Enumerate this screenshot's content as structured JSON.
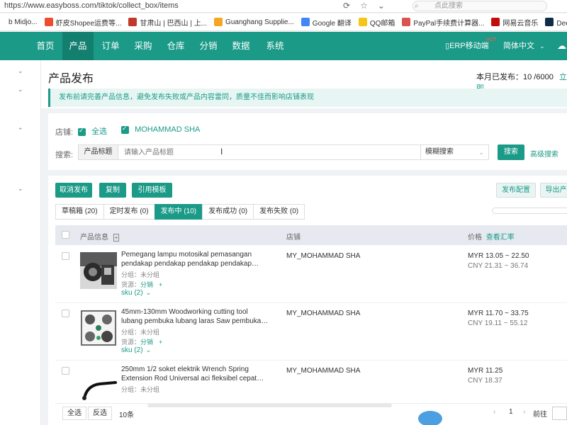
{
  "browser": {
    "url": "https://www.easyboss.com/tiktok/collect_box/items",
    "search_placeholder": "点此搜索",
    "bookmarks": [
      {
        "label": "b Midjo...",
        "color": "#ffffff"
      },
      {
        "label": "虾皮Shopee运费等...",
        "color": "#ee4d2d"
      },
      {
        "label": "甘肃山 | 巴西山 | 上...",
        "color": "#c0392b"
      },
      {
        "label": "Guanghang Supplie...",
        "color": "#f4a623"
      },
      {
        "label": "Google 翻译",
        "color": "#4285f4"
      },
      {
        "label": "QQ邮箱",
        "color": "#f5c518"
      },
      {
        "label": "PayPal手续费计算器...",
        "color": "#d9534f"
      },
      {
        "label": "网易云音乐",
        "color": "#c20c0c"
      },
      {
        "label": "DeepL翻译：全世界...",
        "color": "#0f2b46"
      }
    ]
  },
  "nav": {
    "items": [
      "首页",
      "产品",
      "订单",
      "采购",
      "仓库",
      "分销",
      "数据",
      "系统"
    ],
    "active_index": 1,
    "erp_mobile": "ERP移动端",
    "hot": "HOT",
    "language": "简体中文"
  },
  "page": {
    "title": "产品发布",
    "counter": "本月已发布：10 /6000",
    "counter_link": "立即",
    "notice": "发布前请完善产品信息，避免发布失败或产品内容雷同，质量不佳而影响店铺表现"
  },
  "filter": {
    "shop_label": "店铺:",
    "select_all": "全选",
    "shop_name": "MOHAMMAD SHA",
    "search_label": "搜索:",
    "search_type": "产品标题",
    "search_placeholder": "请输入产品标题",
    "mode": "模糊搜索",
    "search_button": "搜索",
    "advanced": "高级搜索"
  },
  "toolbar": {
    "cancel_publish": "取消发布",
    "copy": "复制",
    "use_template": "引用模板",
    "publish_config": "发布配置",
    "export": "导出产"
  },
  "tabs": [
    "草稿箱 (20)",
    "定时发布 (0)",
    "发布中 (10)",
    "发布成功 (0)",
    "发布失败 (0)"
  ],
  "active_tab": 2,
  "table": {
    "headers": {
      "product": "产品信息",
      "shop": "店铺",
      "price": "价格",
      "rate_link": "查看汇率"
    },
    "rows": [
      {
        "name": "Pemegang lampu motosikal pemasangan pendakap pendakap pendakap pendakap…",
        "group": "分组：未分组",
        "source_label": "货源：",
        "source": "分销",
        "sku": "sku (2)",
        "shop": "MY_MOHAMMAD SHA",
        "price_myr": "MYR 13.05 ~ 22.50",
        "price_cny": "CNY 21.31 ~ 36.74",
        "image": "motorcycle-lamp-holder"
      },
      {
        "name": "45mm-130mm Woodworking cutting tool lubang pembuka lubang laras Saw pembuka…",
        "group": "分组：未分组",
        "source_label": "货源：",
        "source": "分销",
        "sku": "sku (2)",
        "shop": "MY_MOHAMMAD SHA",
        "price_myr": "MYR 11.70 ~ 33.75",
        "price_cny": "CNY 19.11 ~ 55.12",
        "image": "hole-saw-set"
      },
      {
        "name": "250mm 1/2 soket elektrik Wrench Spring Extension Rod Universal aci fleksibel cepat…",
        "group": "分组：未分组",
        "source_label": "",
        "source": "",
        "sku": "",
        "shop": "MY_MOHAMMAD SHA",
        "price_myr": "MYR 11.25",
        "price_cny": "CNY 18.37",
        "image": "flexible-extension-rod"
      }
    ]
  },
  "footer": {
    "select_all": "全选",
    "invert": "反选",
    "count": "10条",
    "page": "1",
    "goto": "前往"
  }
}
